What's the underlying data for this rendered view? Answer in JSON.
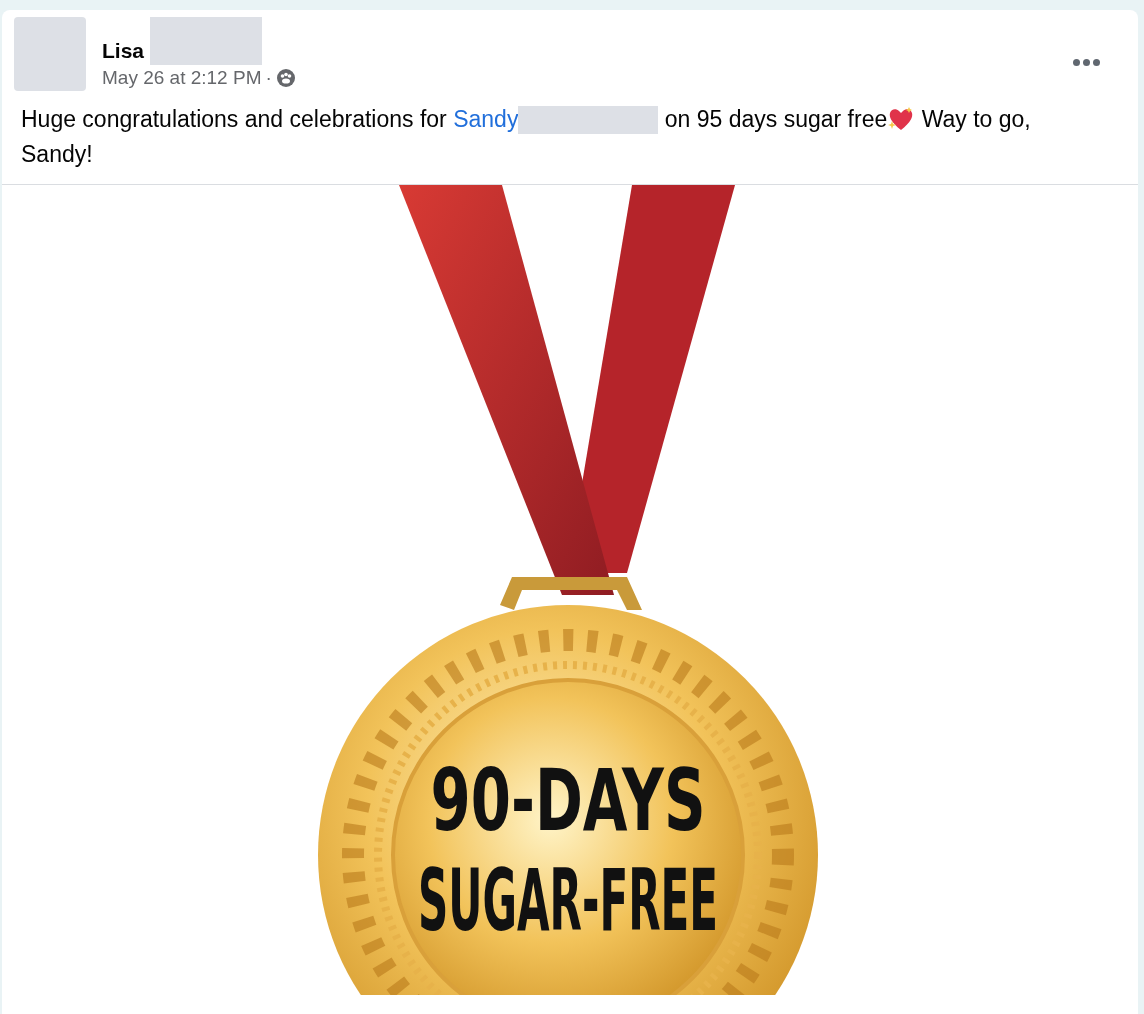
{
  "post": {
    "author_first_name": "Lisa",
    "timestamp": "May 26 at 2:12 PM",
    "separator": "·",
    "body": [
      {
        "kind": "text",
        "text": "Huge congratulations and celebrations for "
      },
      {
        "kind": "link",
        "text": "Sandy"
      },
      {
        "kind": "redacted"
      },
      {
        "kind": "text",
        "text": " on 95 days sugar free"
      },
      {
        "kind": "emoji"
      },
      {
        "kind": "text",
        "text": " Way to go, Sandy!"
      }
    ],
    "image": {
      "kind": "medal",
      "lines": [
        "90-DAYS",
        "SUGAR-FREE"
      ]
    }
  }
}
